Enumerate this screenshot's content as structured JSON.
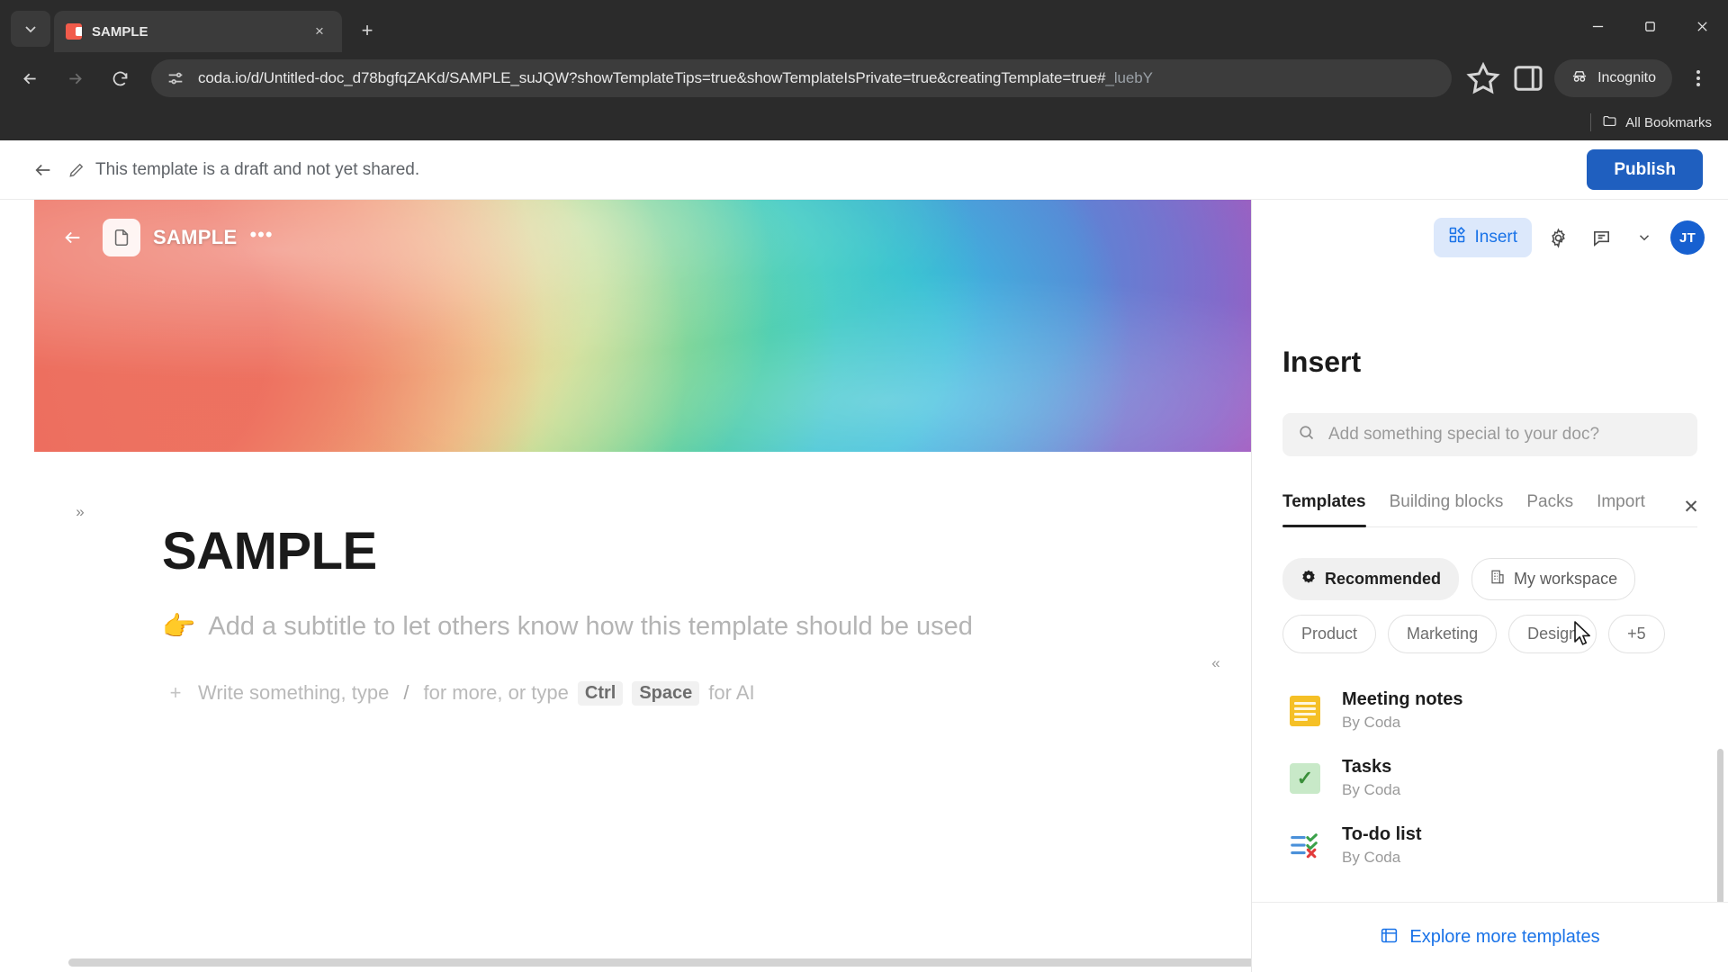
{
  "browser": {
    "tab": {
      "title": "SAMPLE",
      "favicon": "coda-favicon",
      "close_label": "×"
    },
    "new_tab_label": "+",
    "tab_search_name": "tab-search-icon",
    "window_controls": {
      "minimize": "minimize-icon",
      "maximize": "maximize-icon",
      "close": "close-icon"
    },
    "nav": {
      "back": "back-arrow-icon",
      "forward": "forward-arrow-icon",
      "reload": "reload-icon"
    },
    "omnibox": {
      "site_info_icon": "site-settings-icon",
      "url_main": "coda.io/d/Untitled-doc_d78bgfqZAKd/SAMPLE_suJQW?showTemplateTips=true&showTemplateIsPrivate=true&creatingTemplate=true#",
      "url_fragment": "_luebY",
      "bookmark_icon": "star-icon",
      "side_panel_icon": "side-panel-icon",
      "profile_label": "Incognito",
      "profile_icon": "incognito-icon",
      "menu_icon": "kebab-menu-icon"
    },
    "bookmarks_bar": {
      "all_bookmarks_label": "All Bookmarks",
      "folder_icon": "folder-icon"
    }
  },
  "draft_bar": {
    "back_icon": "back-arrow-icon",
    "pencil_icon": "pencil-icon",
    "message": "This template is a draft and not yet shared.",
    "publish_label": "Publish",
    "publish_color": "#1f5fbf"
  },
  "doc": {
    "header": {
      "back_icon": "back-arrow-icon",
      "doc_icon": "document-icon",
      "name": "SAMPLE",
      "more_label": "•••"
    },
    "expand_left_label": "»",
    "collapse_right_label": "«",
    "title": "SAMPLE",
    "subtitle_emoji": "👉",
    "subtitle_placeholder": "Add a subtitle to let others know how this template should be used",
    "body_placeholder": {
      "plus_label": "+",
      "part1": "Write something, type",
      "slash": "/",
      "part2": "for more, or type",
      "key1": "Ctrl",
      "key2": "Space",
      "part3": "for AI"
    }
  },
  "panel": {
    "topbar": {
      "insert_label": "Insert",
      "insert_icon": "insert-blocks-icon",
      "settings_icon": "gear-icon",
      "comment_icon": "comment-icon",
      "chevron_icon": "chevron-down-icon",
      "avatar_initials": "JT",
      "avatar_color": "#1760d0"
    },
    "close_label": "✕",
    "title": "Insert",
    "search": {
      "icon": "search-icon",
      "placeholder": "Add something special to your doc?"
    },
    "tabs": [
      {
        "label": "Templates",
        "active": true
      },
      {
        "label": "Building blocks",
        "active": false
      },
      {
        "label": "Packs",
        "active": false
      },
      {
        "label": "Import",
        "active": false
      }
    ],
    "filters_primary": [
      {
        "label": "Recommended",
        "icon": "sparkle-badge-icon",
        "selected": true
      },
      {
        "label": "My workspace",
        "icon": "building-icon",
        "selected": false
      }
    ],
    "filters_secondary": [
      {
        "label": "Product"
      },
      {
        "label": "Marketing"
      },
      {
        "label": "Design"
      },
      {
        "label": "+5"
      }
    ],
    "templates": [
      {
        "name": "Meeting notes",
        "by": "By Coda",
        "thumb": "yellow-note-icon"
      },
      {
        "name": "Tasks",
        "by": "By Coda",
        "thumb": "green-check-icon"
      },
      {
        "name": "To-do list",
        "by": "By Coda",
        "thumb": "todo-list-icon"
      }
    ],
    "footer": {
      "label": "Explore more templates",
      "icon": "explore-templates-icon"
    }
  }
}
